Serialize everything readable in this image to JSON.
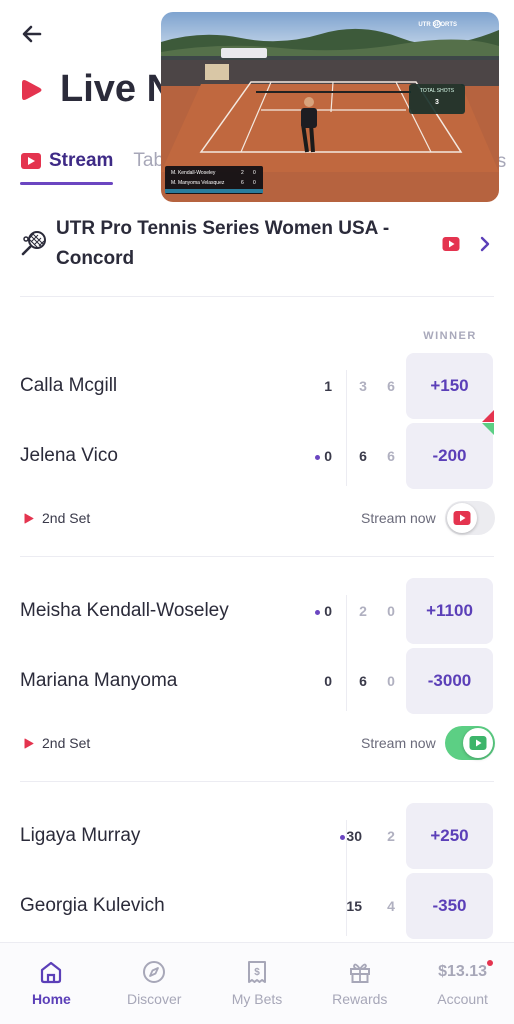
{
  "header": {
    "title": "Live N"
  },
  "tabs": [
    {
      "label": "Stream",
      "active": true
    },
    {
      "label": "Tab",
      "active": false
    },
    {
      "label": "nis",
      "active": false
    }
  ],
  "tournament": {
    "name": "UTR Pro Tennis Series Women USA - Concord"
  },
  "winner_label": "WINNER",
  "matches": [
    {
      "status": "2nd Set",
      "stream_label": "Stream now",
      "stream_on": false,
      "players": [
        {
          "name": "Calla Mcgill",
          "point": "1",
          "serving": false,
          "sets": [
            "3",
            "6"
          ],
          "odds": "+150"
        },
        {
          "name": "Jelena Vico",
          "point": "0",
          "serving": true,
          "sets": [
            "6",
            "6"
          ],
          "odds": "-200"
        }
      ]
    },
    {
      "status": "2nd Set",
      "stream_label": "Stream now",
      "stream_on": true,
      "players": [
        {
          "name": "Meisha Kendall-Woseley",
          "point": "0",
          "serving": true,
          "sets": [
            "2",
            "0"
          ],
          "odds": "+1100"
        },
        {
          "name": "Mariana Manyoma",
          "point": "0",
          "serving": false,
          "sets": [
            "6",
            "0"
          ],
          "odds": "-3000"
        }
      ]
    },
    {
      "players": [
        {
          "name": "Ligaya Murray",
          "point": "30",
          "serving": true,
          "sets": [
            "2"
          ],
          "odds": "+250"
        },
        {
          "name": "Georgia Kulevich",
          "point": "15",
          "serving": false,
          "sets": [
            "4"
          ],
          "odds": "-350"
        }
      ]
    }
  ],
  "video": {
    "brand": "UTR SPORTS",
    "total_shots_label": "TOTAL SHOTS",
    "total_shots_value": "3",
    "scoreboard": [
      {
        "name": "M. Kendall-Woseley",
        "games": "2",
        "points": "0"
      },
      {
        "name": "M. Manyoma Velasquez",
        "games": "6",
        "points": "0"
      }
    ]
  },
  "nav": [
    {
      "label": "Home",
      "icon": "home-icon",
      "active": true
    },
    {
      "label": "Discover",
      "icon": "compass-icon",
      "active": false
    },
    {
      "label": "My Bets",
      "icon": "bet-slip-icon",
      "active": false
    },
    {
      "label": "Rewards",
      "icon": "gift-icon",
      "active": false
    },
    {
      "label": "Account",
      "icon": "balance",
      "active": false,
      "balance": "$13.13"
    }
  ],
  "colors": {
    "accent": "#5b3fb8",
    "brand_red": "#e4344f",
    "toggle_on": "#5ccf84",
    "odds_bg": "#efeef6"
  }
}
